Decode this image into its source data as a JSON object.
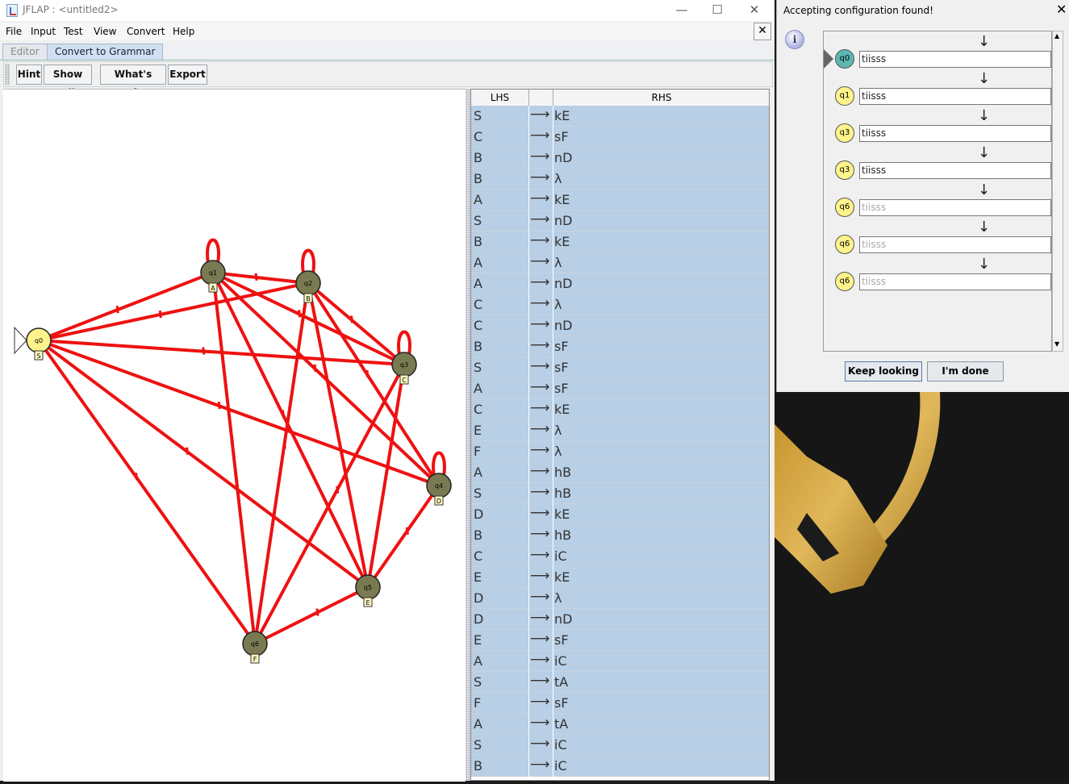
{
  "window": {
    "title": "JFLAP : <untitled2>",
    "controls": {
      "minimize": "—",
      "maximize": "☐",
      "close": "✕"
    }
  },
  "menu": [
    "File",
    "Input",
    "Test",
    "View",
    "Convert",
    "Help"
  ],
  "tabs": {
    "editor": "Editor",
    "convert": "Convert to Grammar"
  },
  "toolbar": {
    "hint": "Hint",
    "show_all": "Show All",
    "whats_left": "What's Left?",
    "export": "Export"
  },
  "table": {
    "headers": {
      "lhs": "LHS",
      "arrow": "",
      "rhs": "RHS"
    },
    "arrow_glyph": "⟶",
    "rows": [
      [
        "S",
        "kE"
      ],
      [
        "C",
        "sF"
      ],
      [
        "B",
        "nD"
      ],
      [
        "B",
        "λ"
      ],
      [
        "A",
        "kE"
      ],
      [
        "S",
        "nD"
      ],
      [
        "B",
        "kE"
      ],
      [
        "A",
        "λ"
      ],
      [
        "A",
        "nD"
      ],
      [
        "C",
        "λ"
      ],
      [
        "C",
        "nD"
      ],
      [
        "B",
        "sF"
      ],
      [
        "S",
        "sF"
      ],
      [
        "A",
        "sF"
      ],
      [
        "C",
        "kE"
      ],
      [
        "E",
        "λ"
      ],
      [
        "F",
        "λ"
      ],
      [
        "A",
        "hB"
      ],
      [
        "S",
        "hB"
      ],
      [
        "D",
        "kE"
      ],
      [
        "B",
        "hB"
      ],
      [
        "C",
        "iC"
      ],
      [
        "E",
        "kE"
      ],
      [
        "D",
        "λ"
      ],
      [
        "D",
        "nD"
      ],
      [
        "E",
        "sF"
      ],
      [
        "A",
        "iC"
      ],
      [
        "S",
        "tA"
      ],
      [
        "F",
        "sF"
      ],
      [
        "A",
        "tA"
      ],
      [
        "S",
        "iC"
      ],
      [
        "B",
        "iC"
      ]
    ]
  },
  "automaton": {
    "states": [
      {
        "name": "q0",
        "label": "S",
        "initial": true,
        "highlight": "yellow"
      },
      {
        "name": "q1",
        "label": "A"
      },
      {
        "name": "q2",
        "label": "B"
      },
      {
        "name": "q3",
        "label": "C"
      },
      {
        "name": "q4",
        "label": "D"
      },
      {
        "name": "q5",
        "label": "E"
      },
      {
        "name": "q6",
        "label": "F"
      }
    ],
    "edge_color": "#ee1111"
  },
  "dialog": {
    "title": "Accepting configuration found!",
    "close": "✕",
    "info_glyph": "i",
    "configs": [
      {
        "state": "q0",
        "read": "tiisss",
        "rest": "",
        "active": true
      },
      {
        "state": "q1",
        "read": "tiisss",
        "rest": ""
      },
      {
        "state": "q3",
        "read": "tiisss",
        "rest": ""
      },
      {
        "state": "q3",
        "read": "tiisss",
        "rest": ""
      },
      {
        "state": "q6",
        "read": "tiisss",
        "rest": ""
      },
      {
        "state": "q6",
        "read": "tiisss",
        "rest": ""
      },
      {
        "state": "q6",
        "read": "tiisss",
        "rest": ""
      }
    ],
    "buttons": {
      "keep_looking": "Keep looking",
      "done": "I'm done"
    }
  },
  "colors": {
    "state_fill": "#7a7a52",
    "initial_fill": "#fef48b",
    "active_fill": "#5cb8b2",
    "row_bg": "#b8cfe5"
  }
}
